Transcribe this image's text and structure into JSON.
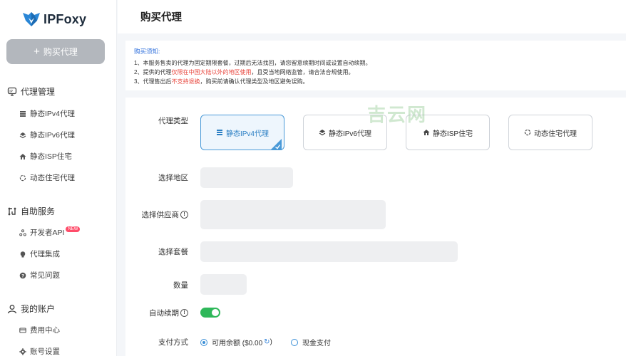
{
  "app": {
    "logo_text": "IPFoxy"
  },
  "sidebar": {
    "buy_button": "购买代理",
    "groups": [
      {
        "title": "代理管理",
        "items": [
          "静态IPv4代理",
          "静态IPv6代理",
          "静态ISP住宅",
          "动态住宅代理"
        ]
      },
      {
        "title": "自助服务",
        "items": [
          "开发者API",
          "代理集成",
          "常见问题"
        ],
        "badge": "NEW"
      },
      {
        "title": "我的账户",
        "items": [
          "费用中心",
          "账号设置"
        ]
      }
    ]
  },
  "header": {
    "title": "购买代理"
  },
  "notice": {
    "title": "购买须知:",
    "line1": "1、本服务售卖的代理为固定期限套餐，过期后无法找回，请您留意续期时间或设置自动续期。",
    "line2_a": "2、提供的代理",
    "line2_b": "仅限在中国大陆以外的地区使用",
    "line2_c": "，且受当地网络监管，请合法合规使用。",
    "line3_a": "3、代理售出后",
    "line3_b": "不支持退换",
    "line3_c": "，购买前请确认代理类型及地区避免误购。"
  },
  "form": {
    "labels": {
      "proxy_type": "代理类型",
      "region": "选择地区",
      "supplier": "选择供应商",
      "package": "选择套餐",
      "quantity": "数量",
      "auto_renew": "自动续期",
      "payment": "支付方式"
    },
    "proxy_types": [
      "静态IPv4代理",
      "静态IPv6代理",
      "静态ISP住宅",
      "动态住宅代理"
    ],
    "payment": {
      "balance": "可用余额 ($0.00",
      "balance_close": ")",
      "cash": "现金支付"
    }
  },
  "watermark": "吉云网",
  "colors": {
    "accent": "#2f80d8",
    "toggle": "#2fb85a",
    "warning": "#e8453c"
  }
}
